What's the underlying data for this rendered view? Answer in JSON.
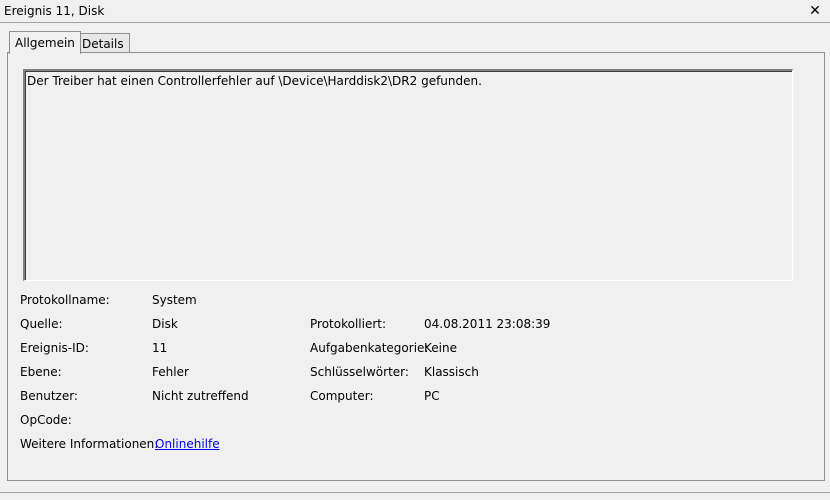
{
  "window": {
    "title": "Ereignis 11, Disk",
    "close_symbol": "✕"
  },
  "tabs": [
    {
      "label": "Allgemein",
      "active": true
    },
    {
      "label": "Details",
      "active": false
    }
  ],
  "description": "Der Treiber hat einen Controllerfehler auf \\Device\\Harddisk2\\DR2 gefunden.",
  "fields": {
    "protokollname": {
      "label": "Protokollname:",
      "value": "System"
    },
    "quelle": {
      "label": "Quelle:",
      "value": "Disk"
    },
    "protokolliert": {
      "label": "Protokolliert:",
      "value": "04.08.2011 23:08:39"
    },
    "ereignis_id": {
      "label": "Ereignis-ID:",
      "value": "11"
    },
    "aufgabenkategorie": {
      "label": "Aufgabenkategorie:",
      "value": "Keine"
    },
    "ebene": {
      "label": "Ebene:",
      "value": "Fehler"
    },
    "schluesselwoerter": {
      "label": "Schlüsselwörter:",
      "value": "Klassisch"
    },
    "benutzer": {
      "label": "Benutzer:",
      "value": "Nicht zutreffend"
    },
    "computer": {
      "label": "Computer:",
      "value": "PC"
    },
    "opcode": {
      "label": "OpCode:",
      "value": ""
    },
    "weitere_informationen": {
      "label": "Weitere Informationen:",
      "link": "Onlinehilfe"
    }
  }
}
